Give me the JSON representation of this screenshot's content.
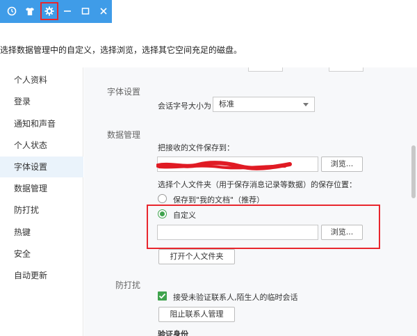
{
  "titlebar": {
    "icons": [
      "history-icon",
      "skin-shirt-icon",
      "settings-gear-icon",
      "minimize-icon",
      "maximize-icon",
      "close-icon"
    ],
    "accent_color": "#3f9ce8",
    "highlight_color": "#e8262d"
  },
  "instruction": "选择数据管理中的自定义，选择浏览，选择其它空间充足的磁盘。",
  "sidebar": {
    "items": [
      {
        "label": "个人资料"
      },
      {
        "label": "登录"
      },
      {
        "label": "通知和声音"
      },
      {
        "label": "个人状态"
      },
      {
        "label": "字体设置"
      },
      {
        "label": "数据管理"
      },
      {
        "label": "防打扰"
      },
      {
        "label": "热键"
      },
      {
        "label": "安全"
      },
      {
        "label": "自动更新"
      }
    ],
    "active_label": "字体设置"
  },
  "font_section": {
    "title": "字体设置",
    "size_label": "会话字号大小为",
    "size_value": "标准"
  },
  "data_section": {
    "title": "数据管理",
    "save_received_label": "把接收的文件保存到：",
    "browse_label_1": "浏览...",
    "personal_folder_label": "选择个人文件夹（用于保存消息记录等数据）的保存位置：",
    "option_my_docs": "保存到\"我的文档\"（推荐）",
    "option_custom": "自定义",
    "custom_path_value": "",
    "browse_label_2": "浏览...",
    "open_folder_label": "打开个人文件夹"
  },
  "anti_disturb_section": {
    "title": "防打扰",
    "accept_unverified_label": "接受未验证联系人,陌生人的临时会话",
    "block_contacts_label": "阻止联系人管理",
    "verify_identity_label": "验证身份"
  },
  "colors": {
    "radio_checked": "#3fa34d",
    "redaction": "#e01b24"
  }
}
